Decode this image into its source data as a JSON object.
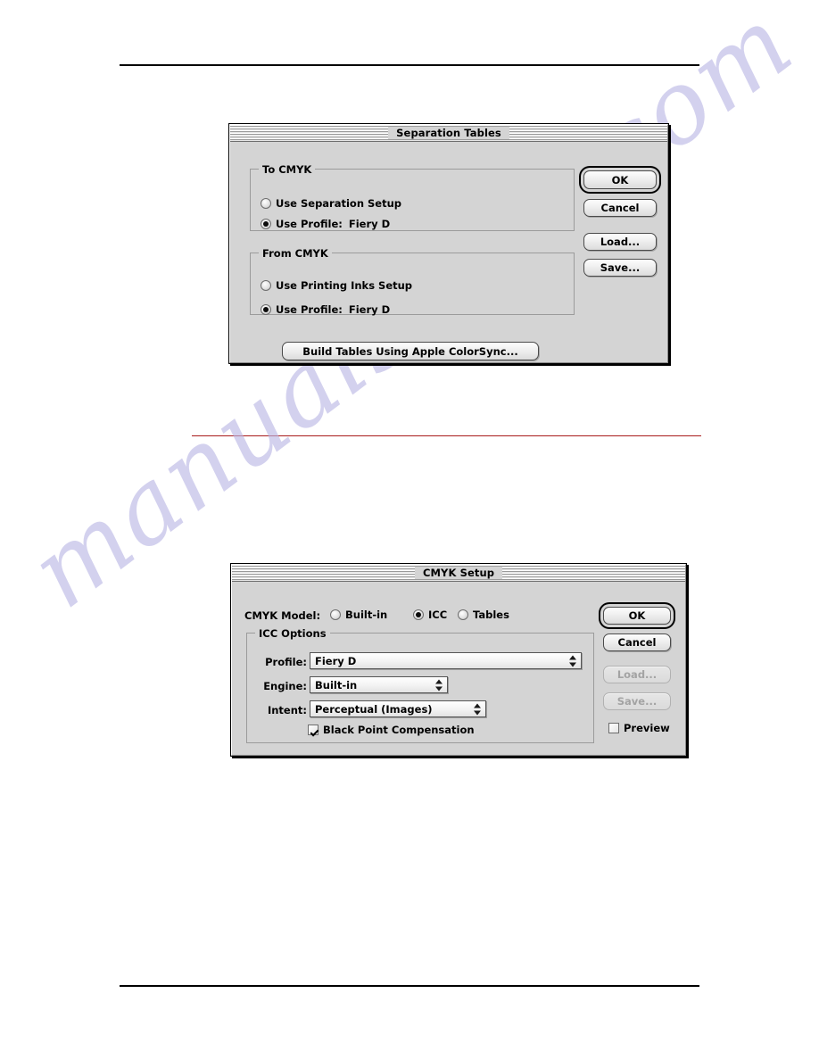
{
  "page": {
    "header_rule": "",
    "footer_rule": "",
    "watermark": "manualshive.com"
  },
  "dialog_separation_tables": {
    "title": "Separation Tables",
    "groups": [
      {
        "title": "To CMYK",
        "options": [
          {
            "label": "Use Separation Setup",
            "selected": false,
            "value": ""
          },
          {
            "label": "Use Profile:",
            "selected": true,
            "value": "Fiery D"
          }
        ]
      },
      {
        "title": "From CMYK",
        "options": [
          {
            "label": "Use Printing Inks Setup",
            "selected": false,
            "value": ""
          },
          {
            "label": "Use Profile:",
            "selected": true,
            "value": "Fiery D"
          }
        ]
      }
    ],
    "build_button": "Build Tables Using Apple ColorSync...",
    "buttons": {
      "ok": "OK",
      "cancel": "Cancel",
      "load": "Load...",
      "save": "Save..."
    }
  },
  "dialog_cmyk_setup": {
    "title": "CMYK Setup",
    "model_label": "CMYK Model:",
    "model_options": [
      {
        "label": "Built-in",
        "selected": false
      },
      {
        "label": "ICC",
        "selected": true
      },
      {
        "label": "Tables",
        "selected": false
      }
    ],
    "icc_options": {
      "title": "ICC Options",
      "fields": [
        {
          "label": "Profile:",
          "value": "Fiery D"
        },
        {
          "label": "Engine:",
          "value": "Built-in"
        },
        {
          "label": "Intent:",
          "value": "Perceptual (Images)"
        }
      ],
      "black_point": {
        "label": "Black Point Compensation",
        "checked": true
      }
    },
    "buttons": {
      "ok": "OK",
      "cancel": "Cancel",
      "load": "Load...",
      "save": "Save..."
    },
    "preview": {
      "label": "Preview",
      "checked": false
    }
  }
}
